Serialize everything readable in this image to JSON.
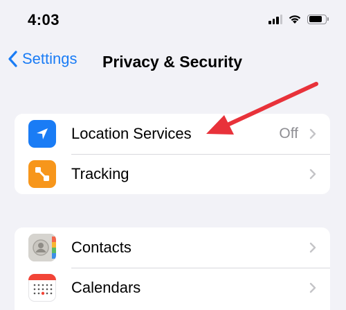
{
  "status_bar": {
    "time": "4:03"
  },
  "nav": {
    "back_label": "Settings",
    "title": "Privacy & Security"
  },
  "group1": [
    {
      "label": "Location Services",
      "value": "Off",
      "icon": "location-arrow-icon",
      "icon_color": "#1a7cf5"
    },
    {
      "label": "Tracking",
      "value": "",
      "icon": "tracking-icon",
      "icon_color": "#f7961b"
    }
  ],
  "group2": [
    {
      "label": "Contacts",
      "value": "",
      "icon": "contacts-icon",
      "icon_color": "#d9d9d6"
    },
    {
      "label": "Calendars",
      "value": "",
      "icon": "calendar-icon",
      "icon_color": "#ffffff"
    }
  ],
  "colors": {
    "accent": "#1a7cf5",
    "annotation_arrow": "#e8323a",
    "background": "#f2f2f7"
  }
}
